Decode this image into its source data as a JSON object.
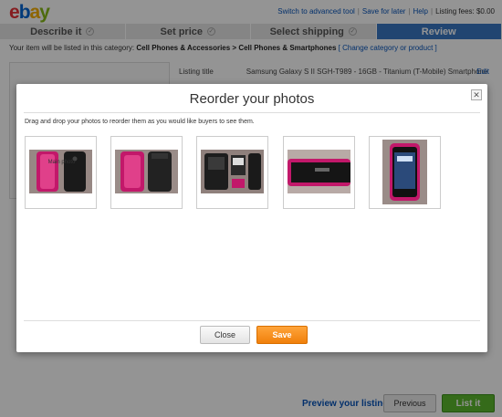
{
  "header": {
    "logo_letters": [
      "e",
      "b",
      "a",
      "y"
    ],
    "links": [
      "Switch to advanced tool",
      "Save for later",
      "Help"
    ],
    "listing_fees": "Listing fees: $0.00"
  },
  "steps": [
    {
      "label": "Describe it",
      "done": true
    },
    {
      "label": "Set price",
      "done": true
    },
    {
      "label": "Select shipping",
      "done": true
    },
    {
      "label": "Review",
      "done": false,
      "active": true
    }
  ],
  "category": {
    "prefix": "Your item will be listed in this category:",
    "path": "Cell Phones & Accessories > Cell Phones & Smartphones",
    "change_link": "[ Change category or product ]"
  },
  "listing": {
    "label": "Listing title",
    "value": "Samsung Galaxy S II SGH-T989 - 16GB - Titanium (T-Mobile) Smartphone",
    "edit_label": "Edit"
  },
  "footer": {
    "preview_link": "Preview your listing",
    "previous_button": "Previous",
    "list_button": "List it"
  },
  "dialog": {
    "title": "Reorder your photos",
    "close_icon": "close-icon",
    "instructions": "Drag and drop your photos to reorder them as you would like buyers to see them.",
    "photos": [
      {
        "id": "photo-1",
        "caption": "Main photo"
      },
      {
        "id": "photo-2"
      },
      {
        "id": "photo-3"
      },
      {
        "id": "photo-4"
      },
      {
        "id": "photo-5"
      }
    ],
    "close_button": "Close",
    "save_button": "Save"
  },
  "colors": {
    "accent": "#3a78c3",
    "save": "#f0800b",
    "list": "#5cb82e",
    "link": "#0654ba"
  }
}
